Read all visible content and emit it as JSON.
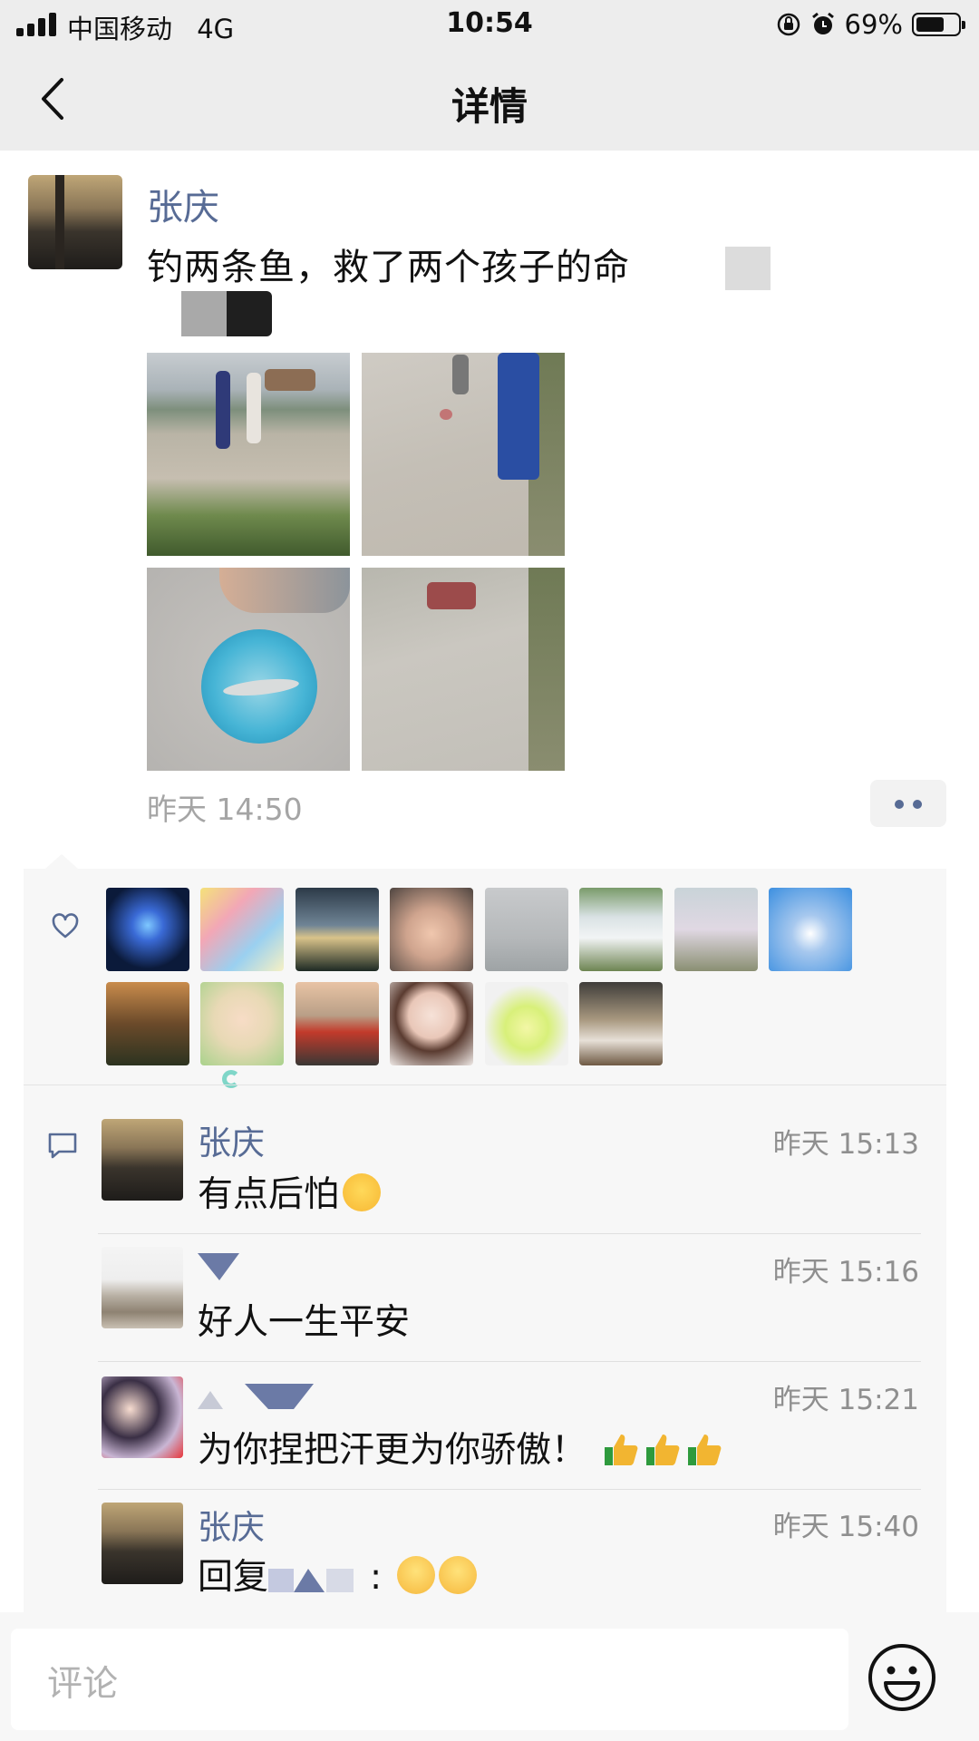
{
  "status_bar": {
    "carrier": "中国移动",
    "network": "4G",
    "time": "10:54",
    "battery": "69%",
    "battery_level": 0.69,
    "icons": [
      "signal-icon",
      "rotation-lock-icon",
      "alarm-icon",
      "battery-icon"
    ]
  },
  "nav": {
    "title": "详情",
    "back_icon": "chevron-left-icon"
  },
  "post": {
    "author": "张庆",
    "text": "钓两条鱼，救了两个孩子的命",
    "photo_count": 4,
    "time": "昨天 14:50",
    "more_icon": "more-dots-icon"
  },
  "likes": {
    "icon": "heart-outline-icon",
    "avatar_count": 14
  },
  "comments": {
    "icon": "comment-icon",
    "items": [
      {
        "name": "张庆",
        "time": "昨天 15:13",
        "text": "有点后怕",
        "emoji": "dizzy-face-emoji"
      },
      {
        "name": "",
        "time": "昨天 15:16",
        "text": "好人一生平安"
      },
      {
        "name": "",
        "time": "昨天 15:21",
        "text": "为你捏把汗更为你骄傲！",
        "emoji": "thumbs-up-emoji"
      },
      {
        "name": "张庆",
        "time": "昨天 15:40",
        "text_prefix": "回复",
        "text_suffix": ":",
        "emoji": "smiling-face-emoji"
      }
    ]
  },
  "input": {
    "placeholder": "评论",
    "emoji_icon": "smiley-face-icon"
  },
  "colors": {
    "link": "#576b95",
    "panel": "#f7f7f7",
    "topbar": "#ededed"
  }
}
